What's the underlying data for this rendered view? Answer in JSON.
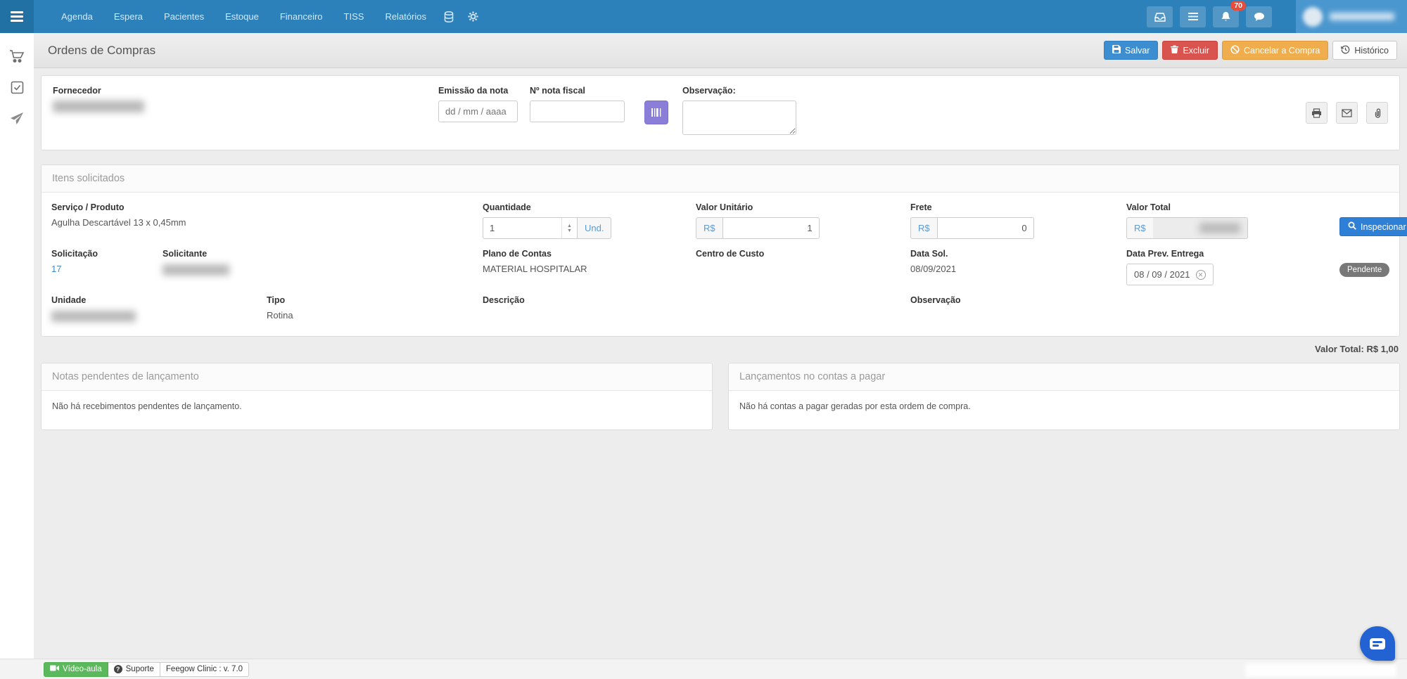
{
  "colors": {
    "navbar": "#2c81ba",
    "primary": "#3d8ed0",
    "danger": "#d9534f",
    "warning": "#f0ad4e",
    "success": "#5cb85c",
    "purple_button": "#8b7ed8",
    "badge_red": "#e74c3c",
    "chat_blue": "#2262d3"
  },
  "navbar": {
    "menu": [
      "Agenda",
      "Espera",
      "Pacientes",
      "Estoque",
      "Financeiro",
      "TISS",
      "Relatórios"
    ],
    "notification_count": "70"
  },
  "header": {
    "title": "Ordens de Compras",
    "save_label": "Salvar",
    "delete_label": "Excluir",
    "cancel_label": "Cancelar a Compra",
    "history_label": "Histórico"
  },
  "order_form": {
    "supplier_label": "Fornecedor",
    "issue_date_label": "Emissão da nota",
    "issue_date_placeholder": "dd / mm / aaaa",
    "invoice_label": "Nº nota fiscal",
    "observation_label": "Observação:"
  },
  "items": {
    "section_title": "Itens solicitados",
    "product_label": "Serviço / Produto",
    "product_value": "Agulha Descartável 13 x 0,45mm",
    "quantity_label": "Quantidade",
    "quantity_value": "1",
    "unit_label": "Und.",
    "currency": "R$",
    "unit_price_label": "Valor Unitário",
    "unit_price_value": "1",
    "freight_label": "Frete",
    "freight_value": "0",
    "total_label": "Valor Total",
    "inspect_label": "Inspecionar",
    "request_label": "Solicitação",
    "request_value": "17",
    "requester_label": "Solicitante",
    "account_plan_label": "Plano de Contas",
    "account_plan_value": "MATERIAL HOSPITALAR",
    "cost_center_label": "Centro de Custo",
    "request_date_label": "Data Sol.",
    "request_date_value": "08/09/2021",
    "delivery_date_label": "Data Prev. Entrega",
    "delivery_date_value": "08 / 09 / 2021",
    "status_badge": "Pendente",
    "unit_org_label": "Unidade",
    "type_label": "Tipo",
    "type_value": "Rotina",
    "description_label": "Descrição",
    "observation_label": "Observação",
    "total_summary": "Valor Total: R$ 1,00"
  },
  "pending_notes": {
    "title": "Notas pendentes de lançamento",
    "empty_message": "Não há recebimentos pendentes de lançamento."
  },
  "payables": {
    "title": "Lançamentos no contas a pagar",
    "empty_message": "Não há contas a pagar geradas por esta ordem de compra."
  },
  "footer": {
    "video_label": "Vídeo-aula",
    "support_label": "Suporte",
    "version_label": "Feegow Clinic : v. 7.0"
  }
}
